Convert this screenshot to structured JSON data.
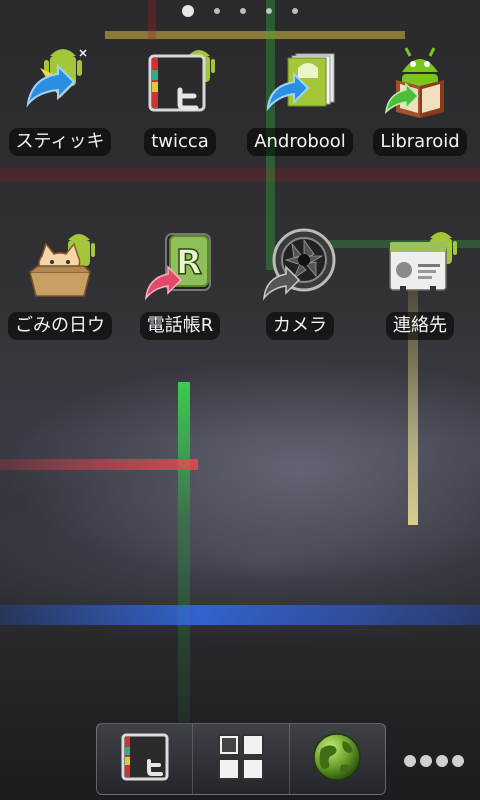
{
  "page_indicator": {
    "count": 5,
    "active_index": 0
  },
  "apps": [
    {
      "id": "sticky",
      "label": "スティッキ",
      "icon": "sticky-note-icon"
    },
    {
      "id": "twicca",
      "label": "twicca",
      "icon": "twicca-icon"
    },
    {
      "id": "androbook",
      "label": "Androbool",
      "icon": "androbook-icon"
    },
    {
      "id": "libraroid",
      "label": "Libraroid",
      "icon": "libraroid-book-icon"
    },
    {
      "id": "gomi",
      "label": "ごみの日ウ",
      "icon": "cat-in-box-icon"
    },
    {
      "id": "denwacho",
      "label": "電話帳R",
      "icon": "phonebook-r-icon"
    },
    {
      "id": "camera",
      "label": "カメラ",
      "icon": "camera-lens-icon"
    },
    {
      "id": "contacts",
      "label": "連絡先",
      "icon": "contacts-card-icon"
    }
  ],
  "dock": {
    "items": [
      {
        "id": "twicca",
        "icon": "twicca-icon"
      },
      {
        "id": "all_apps",
        "icon": "app-drawer-grid-icon"
      },
      {
        "id": "browser",
        "icon": "globe-icon"
      }
    ],
    "more_icon": "more-dots-icon"
  }
}
